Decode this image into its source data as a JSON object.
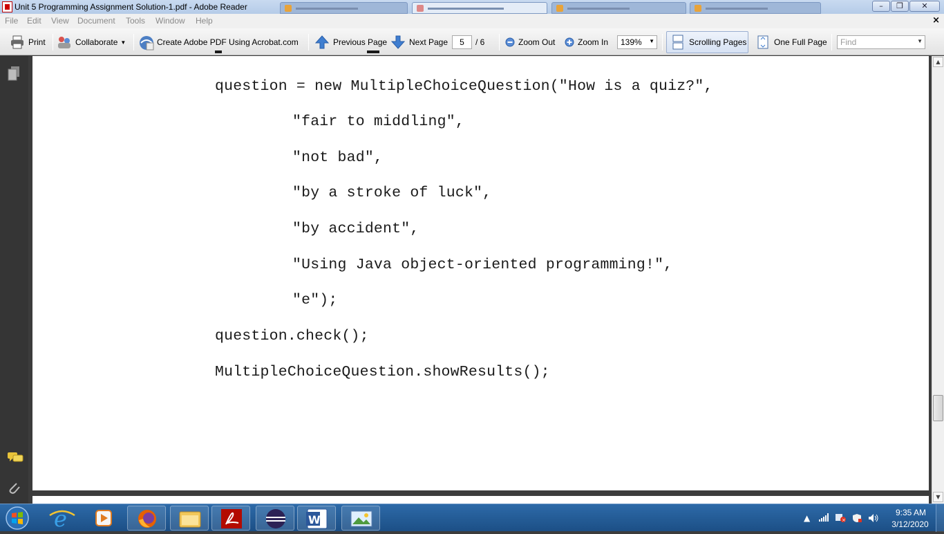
{
  "window": {
    "title": "Unit 5 Programming Assignment Solution-1.pdf - Adobe Reader",
    "minimize": "–",
    "maximize": "❐",
    "close": "✕",
    "doc_close": "×"
  },
  "menu": [
    "File",
    "Edit",
    "View",
    "Document",
    "Tools",
    "Window",
    "Help"
  ],
  "toolbar": {
    "print": "Print",
    "collaborate": "Collaborate",
    "create_pdf": "Create Adobe PDF Using Acrobat.com",
    "previous_page": "Previous Page",
    "next_page": "Next Page",
    "page_current": "5",
    "page_total": "/ 6",
    "zoom_out": "Zoom Out",
    "zoom_in": "Zoom In",
    "zoom_level": "139%",
    "scrolling_pages": "Scrolling Pages",
    "one_full_page": "One Full Page",
    "find_placeholder": "Find"
  },
  "document": {
    "lines": [
      "question = new MultipleChoiceQuestion(\"How is a quiz?\",",
      "\"fair to middling\",",
      "\"not bad\",",
      "\"by a stroke of luck\",",
      "\"by accident\",",
      "\"Using Java object-oriented programming!\",",
      "\"e\");",
      "question.check();",
      "MultipleChoiceQuestion.showResults();"
    ]
  },
  "taskbar": {
    "clock_time": "9:35 AM",
    "clock_date": "3/12/2020"
  },
  "colors": {
    "acrobat_red": "#b30b00",
    "taskbar_blue": "#1c4f86",
    "page_bg": "#ffffff"
  },
  "icons": {
    "nav": [
      "pages-icon",
      "comments-icon",
      "attachments-icon"
    ],
    "tray": [
      "show-hidden-icons",
      "signal-icon",
      "network-error-icon",
      "action-center-icon",
      "volume-icon"
    ]
  }
}
